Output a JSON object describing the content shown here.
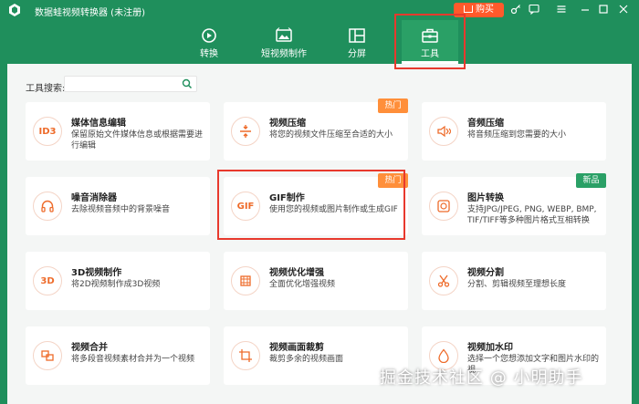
{
  "app": {
    "title": "数据蛙视频转换器 (未注册)"
  },
  "titlebar": {
    "buy_label": "购买"
  },
  "tabs": [
    {
      "label": "转换"
    },
    {
      "label": "短视频制作"
    },
    {
      "label": "分屏"
    },
    {
      "label": "工具"
    }
  ],
  "search": {
    "label": "工具搜索:",
    "value": ""
  },
  "cards": [
    {
      "title": "媒体信息编辑",
      "desc": "保留原始文件媒体信息或根据需要进行编辑",
      "icon": "ID3",
      "badge": ""
    },
    {
      "title": "视频压缩",
      "desc": "将您的视频文件压缩至合适的大小",
      "icon": "compress-icon",
      "badge": "热门"
    },
    {
      "title": "音频压缩",
      "desc": "将音频压缩到您需要的大小",
      "icon": "audio-compress-icon",
      "badge": ""
    },
    {
      "title": "噪音消除器",
      "desc": "去除视频音频中的背景噪音",
      "icon": "headphones-icon",
      "badge": ""
    },
    {
      "title": "GIF制作",
      "desc": "使用您的视频或图片制作或生成GIF",
      "icon": "GIF",
      "badge": "热门"
    },
    {
      "title": "图片转换",
      "desc": "支持JPG/JPEG, PNG, WEBP, BMP, TIF/TIFF等多种图片格式互相转换",
      "icon": "image-convert-icon",
      "badge": "新品"
    },
    {
      "title": "3D视频制作",
      "desc": "将2D视频制作成3D视频",
      "icon": "3D",
      "badge": ""
    },
    {
      "title": "视频优化增强",
      "desc": "全面优化增强视频",
      "icon": "enhance-icon",
      "badge": ""
    },
    {
      "title": "视频分割",
      "desc": "分割、剪辑视频至理想长度",
      "icon": "scissors-icon",
      "badge": ""
    },
    {
      "title": "视频合并",
      "desc": "将多段音视频素材合并为一个视频",
      "icon": "merge-icon",
      "badge": ""
    },
    {
      "title": "视频画面裁剪",
      "desc": "裁剪多余的视频画面",
      "icon": "crop-icon",
      "badge": ""
    },
    {
      "title": "视频加水印",
      "desc": "选择一个您想添加文字和图片水印的视",
      "icon": "watermark-icon",
      "badge": ""
    }
  ],
  "watermark": "掘金技术社区 @ 小明助手",
  "colors": {
    "brand": "#1f8f5c",
    "accent": "#ee6b2a",
    "hot": "#ff8f3a",
    "new": "#2aa066",
    "highlight": "#e8392d"
  }
}
